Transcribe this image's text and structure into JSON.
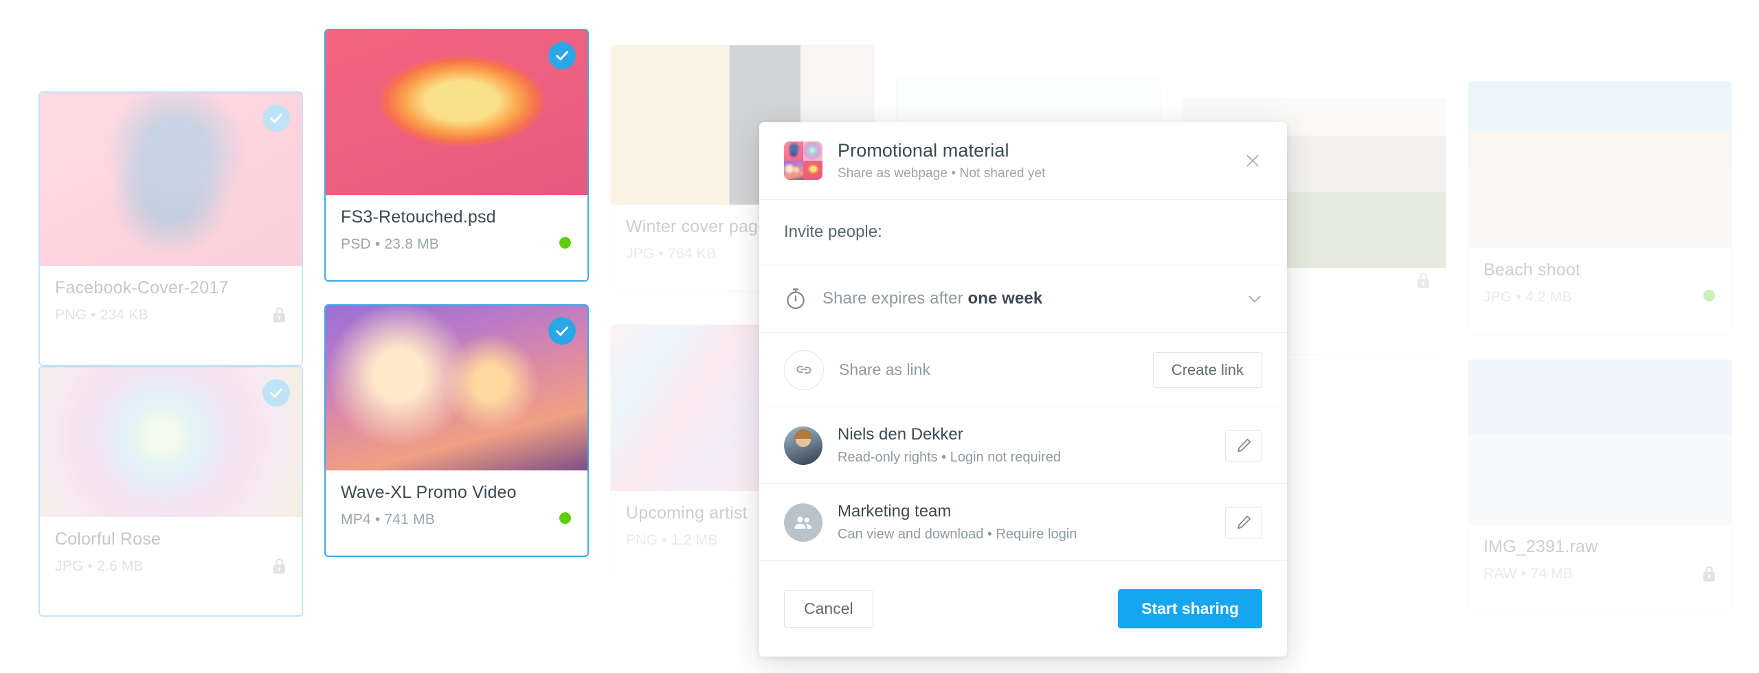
{
  "colors": {
    "accent": "#14a7ef",
    "check_badge": "#2ba6e8",
    "selected_border": "#3fa9e8",
    "status_online": "#5ece0c",
    "text_primary": "#3c4a53",
    "text_muted": "#8e9aa2",
    "card_border": "#e6eaed"
  },
  "grid": {
    "cards": [
      {
        "name": "Facebook-Cover-2017",
        "meta": "PNG  •  234 KB",
        "format": "PNG",
        "size": "234 KB",
        "selected": true,
        "dimmed": true,
        "badge": "check-icon",
        "status": "lock-icon",
        "art": "art-blueface"
      },
      {
        "name": "Colorful Rose",
        "meta": "JPG  •  2.6 MB",
        "format": "JPG",
        "size": "2.6 MB",
        "selected": true,
        "dimmed": true,
        "badge": "check-icon",
        "status": "lock-icon",
        "art": "art-rose"
      },
      {
        "name": "FS3-Retouched.psd",
        "meta": "PSD  •  23.8 MB",
        "format": "PSD",
        "size": "23.8 MB",
        "selected": true,
        "dimmed": false,
        "badge": "check-icon",
        "status": "online-dot",
        "art": "art-chair"
      },
      {
        "name": "Wave-XL Promo Video",
        "meta": "MP4  •  741 MB",
        "format": "MP4",
        "size": "741 MB",
        "selected": true,
        "dimmed": false,
        "badge": "check-icon",
        "status": "online-dot",
        "art": "art-concert"
      },
      {
        "name": "Winter cover page",
        "meta": "JPG  •  764 KB",
        "format": "JPG",
        "size": "764 KB",
        "selected": false,
        "dimmed": true,
        "badge": "",
        "status": "",
        "art": "art-winter"
      },
      {
        "name": "Upcoming artist",
        "meta": "PNG  •  1.2 MB",
        "format": "PNG",
        "size": "1.2 MB",
        "selected": false,
        "dimmed": true,
        "badge": "",
        "status": "",
        "art": "art-artist"
      },
      {
        "name": "",
        "meta": "",
        "format": "",
        "size": "",
        "selected": false,
        "dimmed": true,
        "badge": "",
        "status": "",
        "art": "art-paper"
      },
      {
        "name": "",
        "meta": "",
        "format": "",
        "size": "",
        "selected": false,
        "dimmed": true,
        "badge": "",
        "status": "lock-icon",
        "art": "art-eiffel"
      },
      {
        "name": "",
        "meta": "",
        "format": "",
        "size": "",
        "selected": false,
        "dimmed": true,
        "badge": "",
        "status": "lock-icon",
        "art": "art-bridge"
      },
      {
        "name": "Beach shoot",
        "meta": "JPG  •  4.2 MB",
        "format": "JPG",
        "size": "4.2 MB",
        "selected": false,
        "dimmed": true,
        "badge": "",
        "status": "online-dot",
        "art": "art-beach"
      },
      {
        "name": "IMG_2391.raw",
        "meta": "RAW  •  74 MB",
        "format": "RAW",
        "size": "74 MB",
        "selected": false,
        "dimmed": true,
        "badge": "",
        "status": "lock-icon",
        "art": "art-opera"
      }
    ]
  },
  "modal": {
    "title": "Promotional material",
    "subtitle": "Share as webpage  •  Not shared yet",
    "close_label": "close-icon",
    "invite_label": "Invite people:",
    "expire": {
      "prefix": "Share expires after ",
      "value": "one week",
      "icon": "timer-icon",
      "chevron": "chevron-down-icon"
    },
    "link_row": {
      "icon": "link-icon",
      "label": "Share as link",
      "button": "Create link"
    },
    "people": [
      {
        "name": "Niels den Dekker",
        "rights": "Read-only rights  •  Login not required",
        "avatar": "photo-avatar",
        "edit": "pencil-icon"
      },
      {
        "name": "Marketing team",
        "rights": "Can view and download  •  Require login",
        "avatar": "group-avatar",
        "edit": "pencil-icon"
      }
    ],
    "footer": {
      "cancel": "Cancel",
      "primary": "Start sharing"
    }
  }
}
